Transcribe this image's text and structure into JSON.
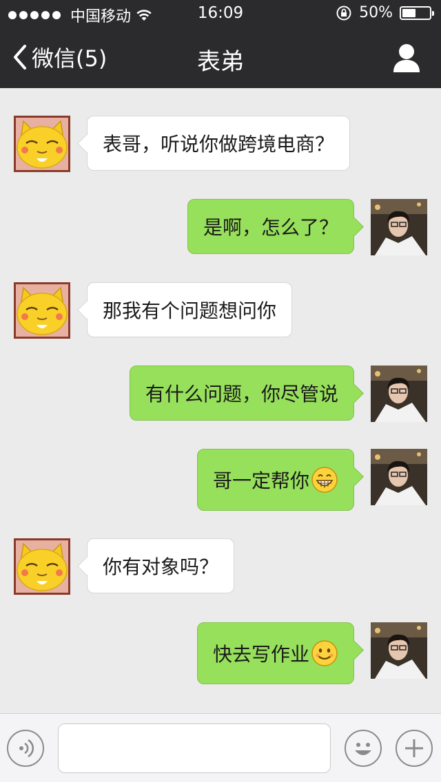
{
  "status": {
    "carrier": "中国移动",
    "time": "16:09",
    "battery": "50%",
    "battery_level": 0.5
  },
  "nav": {
    "back_label": "微信(5)",
    "title": "表弟"
  },
  "messages": [
    {
      "side": "in",
      "text": "表哥，听说你做跨境电商？"
    },
    {
      "side": "out",
      "text": "是啊，怎么了？"
    },
    {
      "side": "in",
      "text": "那我有个问题想问你"
    },
    {
      "side": "out",
      "text": "有什么问题，你尽管说"
    },
    {
      "side": "out",
      "text": "哥一定帮你",
      "emoji": "grin-emoji"
    },
    {
      "side": "in",
      "text": "你有对象吗？"
    },
    {
      "side": "out",
      "text": "快去写作业",
      "emoji": "smile-emoji"
    }
  ],
  "input": {
    "placeholder": ""
  },
  "colors": {
    "topbar": "#2b2b2d",
    "background": "#ebebeb",
    "outgoing_bubble": "#97e05b",
    "incoming_bubble": "#ffffff"
  }
}
